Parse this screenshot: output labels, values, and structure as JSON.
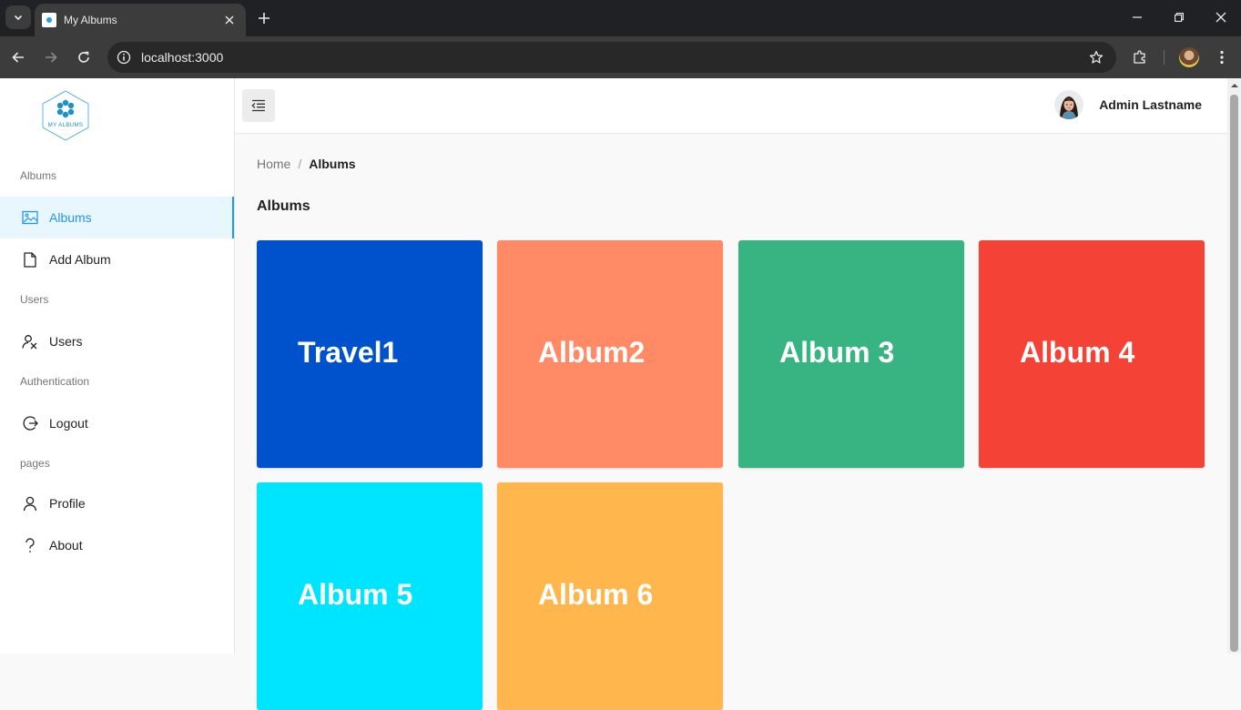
{
  "browser": {
    "tab_title": "My Albums",
    "url": "localhost:3000"
  },
  "sidebar": {
    "logo_text": "MY ALBUMS",
    "sections": [
      {
        "heading": "Albums",
        "items": [
          {
            "label": "Albums",
            "icon": "image-icon",
            "active": true
          },
          {
            "label": "Add Album",
            "icon": "file-icon"
          }
        ]
      },
      {
        "heading": "Users",
        "items": [
          {
            "label": "Users",
            "icon": "users-icon"
          }
        ]
      },
      {
        "heading": "Authentication",
        "items": [
          {
            "label": "Logout",
            "icon": "logout-icon"
          }
        ]
      },
      {
        "heading": "pages",
        "items": [
          {
            "label": "Profile",
            "icon": "user-icon"
          },
          {
            "label": "About",
            "icon": "question-icon"
          }
        ]
      }
    ]
  },
  "header": {
    "user_name": "Admin Lastname"
  },
  "breadcrumb": {
    "home": "Home",
    "separator": "/",
    "current": "Albums"
  },
  "page": {
    "title": "Albums"
  },
  "albums": [
    {
      "name": "Travel1",
      "color": "#0052cc"
    },
    {
      "name": "Album2",
      "color": "#ff8a65"
    },
    {
      "name": "Album 3",
      "color": "#38b482"
    },
    {
      "name": "Album 4",
      "color": "#f44336"
    },
    {
      "name": "Album 5",
      "color": "#00e5ff"
    },
    {
      "name": "Album 6",
      "color": "#ffb74d"
    }
  ],
  "colors": {
    "accent": "#2196f3",
    "active_bg": "#e8f6fe"
  }
}
